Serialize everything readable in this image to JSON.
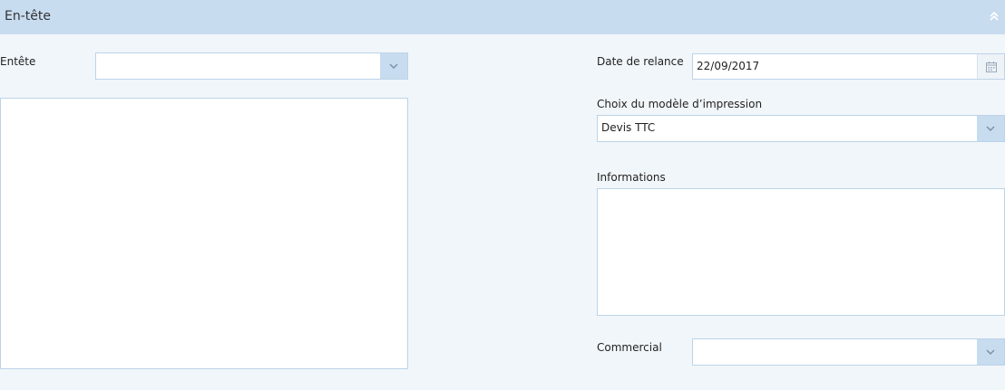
{
  "header": {
    "title": "En-tête"
  },
  "left": {
    "entete_label": "Entête",
    "entete_value": ""
  },
  "right": {
    "date_label": "Date de relance",
    "date_value": "22/09/2017",
    "model_label": "Choix du modèle d’impression",
    "model_value": "Devis TTC",
    "info_label": "Informations",
    "commercial_label": "Commercial",
    "commercial_value": ""
  },
  "icons": {
    "collapse": "double-chevron-up-icon",
    "dropdown": "chevron-down-icon",
    "calendar": "calendar-icon"
  }
}
